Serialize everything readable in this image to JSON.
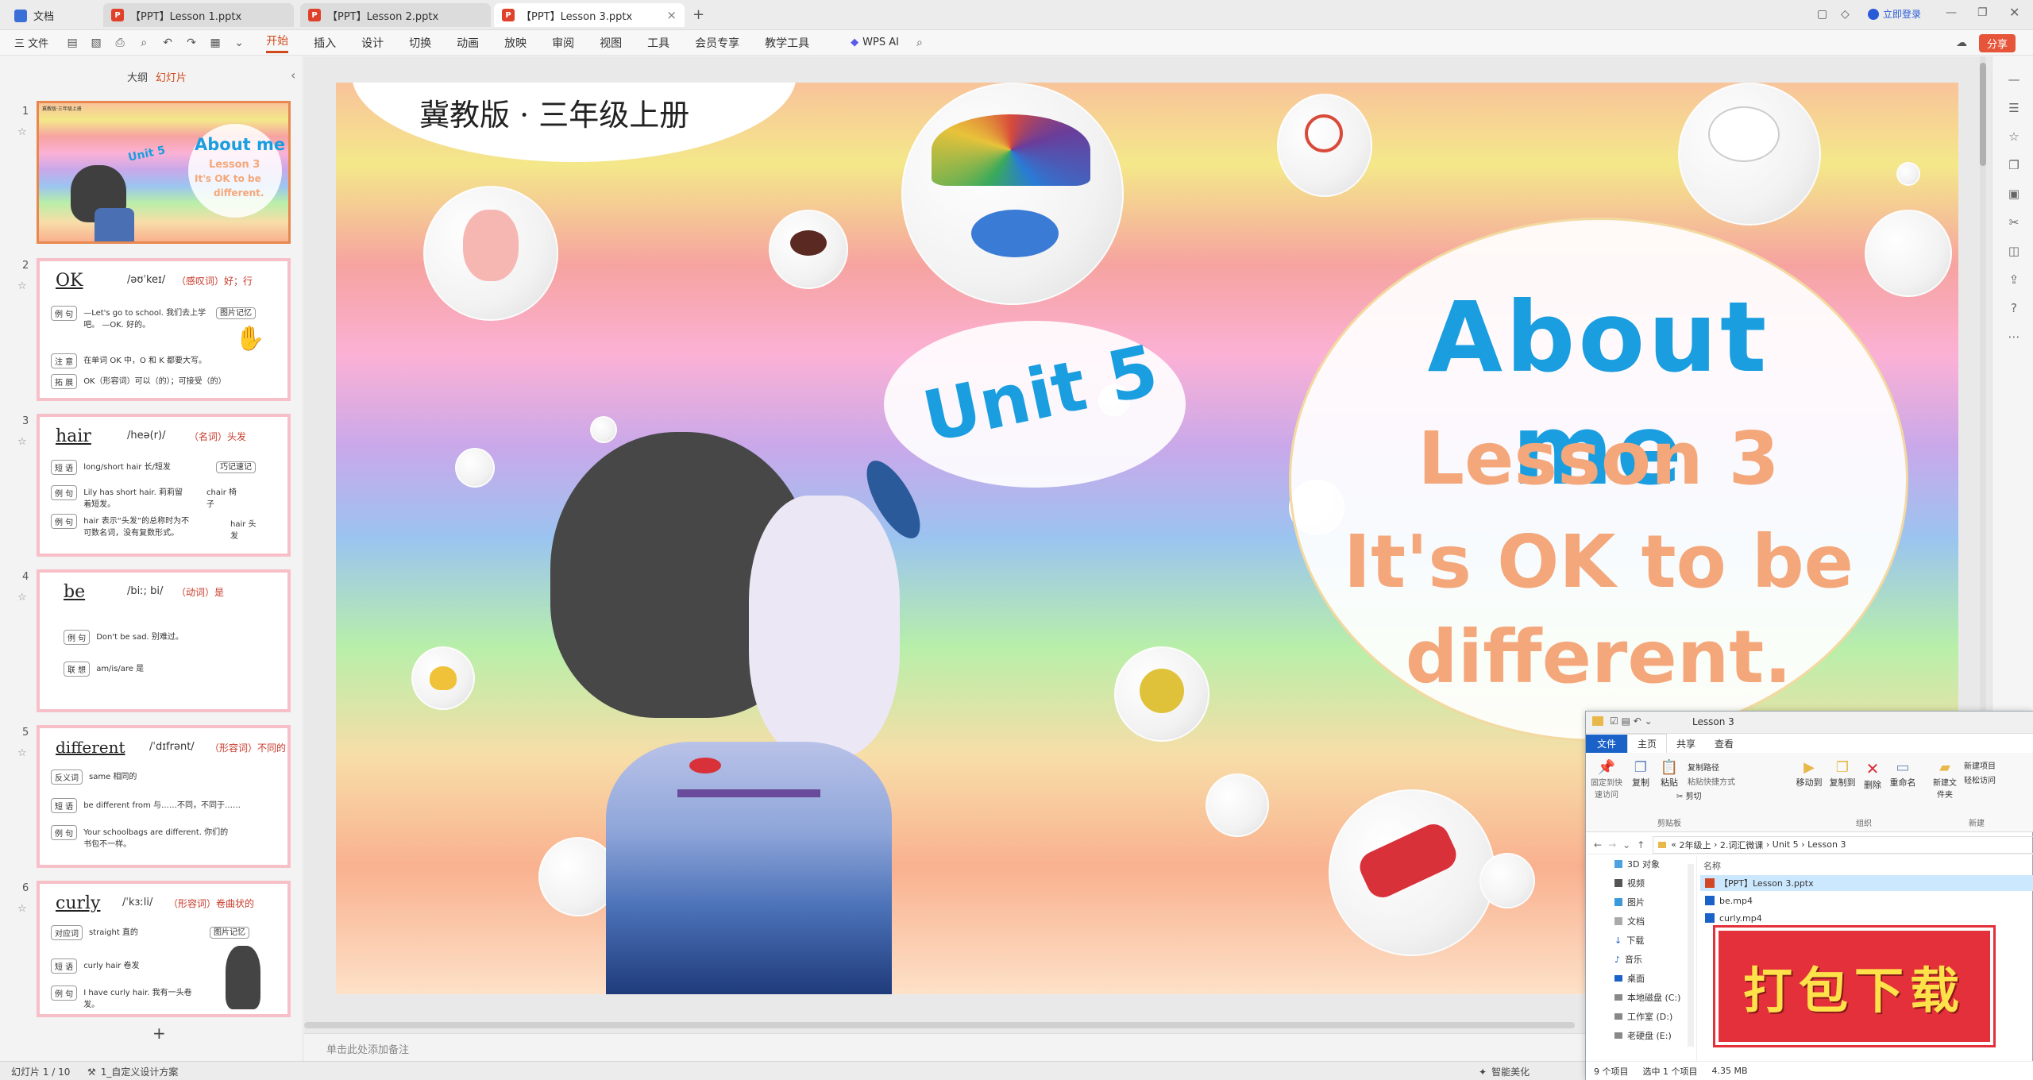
{
  "titlebar": {
    "home_label": "文档",
    "tabs": [
      {
        "label": "【PPT】Lesson 1.pptx",
        "active": false
      },
      {
        "label": "【PPT】Lesson 2.pptx",
        "active": false
      },
      {
        "label": "【PPT】Lesson 3.pptx",
        "active": true
      }
    ],
    "login_label": "立即登录"
  },
  "menubar": {
    "file_label": "三 文件",
    "items": [
      "开始",
      "插入",
      "设计",
      "切换",
      "动画",
      "放映",
      "审阅",
      "视图",
      "工具",
      "会员专享",
      "教学工具"
    ],
    "active_item": "开始",
    "wps_ai_label": "WPS AI",
    "share_label": "分享"
  },
  "left_panel": {
    "tabs": [
      "大纲",
      "幻灯片"
    ],
    "active_tab": "幻灯片",
    "thumbnails": [
      {
        "num": "1",
        "title": "About me",
        "subtitle": "Lesson 3",
        "line1": "It's OK to be",
        "line2": "different.",
        "unit": "Unit 5",
        "header": "冀教版·三年级上册"
      },
      {
        "num": "2",
        "word": "OK",
        "phon": "/əʊˈkeɪ/",
        "meaning": "（感叹词）好；行",
        "rows": [
          {
            "badge": "例 句",
            "text": "—Let's go to school.  我们去上学吧。  —OK. 好的。"
          },
          {
            "badge": "注 意",
            "text": "在单词 OK 中，O 和 K 都要大写。"
          },
          {
            "badge": "拓 展",
            "text": "OK（形容词）可以（的）；可接受（的）"
          }
        ],
        "side": "图片记忆"
      },
      {
        "num": "3",
        "word": "hair",
        "phon": "/heə(r)/",
        "meaning": "（名词）头发",
        "rows": [
          {
            "badge": "短 语",
            "text": "long/short hair 长/短发"
          },
          {
            "badge": "例 句",
            "text": "Lily has short hair.  莉莉留着短发。"
          },
          {
            "badge": "例 句",
            "text": "hair 表示“头发”的总称时为不可数名词，没有复数形式。"
          }
        ],
        "side": "巧记速记",
        "side2": "chair 椅子",
        "side3": "hair 头发"
      },
      {
        "num": "4",
        "word": "be",
        "phon": "/biː; bi/",
        "meaning": "（动词）是",
        "rows": [
          {
            "badge": "例 句",
            "text": "Don't be sad. 别难过。"
          },
          {
            "badge": "联 想",
            "text": "am/is/are 是"
          }
        ]
      },
      {
        "num": "5",
        "word": "different",
        "phon": "/ˈdɪfrənt/",
        "meaning": "（形容词）不同的",
        "rows": [
          {
            "badge": "反义词",
            "text": "same 相同的"
          },
          {
            "badge": "短 语",
            "text": "be different from 与……不同，不同于……"
          },
          {
            "badge": "例 句",
            "text": "Your schoolbags are different.  你们的书包不一样。"
          }
        ]
      },
      {
        "num": "6",
        "word": "curly",
        "phon": "/ˈkɜːli/",
        "meaning": "（形容词）卷曲状的",
        "rows": [
          {
            "badge": "对应词",
            "text": "straight 直的"
          },
          {
            "badge": "短 语",
            "text": "curly hair 卷发"
          },
          {
            "badge": "例 句",
            "text": "I have curly hair.  我有一头卷发。"
          }
        ],
        "side": "图片记忆"
      }
    ],
    "add_label": "+"
  },
  "slide": {
    "header": "冀教版 · 三年级上册",
    "title": "About me",
    "lesson": "Lesson 3",
    "line1": "It's OK to be",
    "line2": "different.",
    "unit": "Unit 5",
    "colors": {
      "title": "#1a9ee0",
      "lesson": "#f4a77a"
    }
  },
  "notes_placeholder": "单击此处添加备注",
  "statusbar": {
    "slide_counter": "幻灯片 1 / 10",
    "theme": "1_自定义设计方案",
    "smart_label": "智能美化"
  },
  "explorer": {
    "title": "Lesson 3",
    "ribbon_tabs": [
      "文件",
      "主页",
      "共享",
      "查看"
    ],
    "active_ribbon_tab": "主页",
    "ribbon": {
      "pin": "固定到快速访问",
      "copy": "复制",
      "paste": "粘贴",
      "copy_path": "复制路径",
      "paste_shortcut": "粘贴快捷方式",
      "cut": "剪切",
      "move_to": "移动到",
      "copy_to": "复制到",
      "delete": "删除",
      "rename": "重命名",
      "new_folder": "新建文件夹",
      "new_item": "新建项目",
      "easy_access": "轻松访问",
      "group_clipboard": "剪贴板",
      "group_organize": "组织",
      "group_new": "新建"
    },
    "breadcrumb": [
      "«",
      "2年级上",
      "2.词汇微课",
      "Unit 5",
      "Lesson 3"
    ],
    "column_header": "名称",
    "nav_items": [
      "3D 对象",
      "视频",
      "图片",
      "文档",
      "下载",
      "音乐",
      "桌面",
      "本地磁盘 (C:)",
      "工作室 (D:)",
      "老硬盘 (E:)"
    ],
    "files": [
      "【PPT】Lesson 3.pptx",
      "be.mp4",
      "curly.mp4"
    ],
    "status_count": "9 个项目",
    "status_selected": "选中 1 个项目",
    "status_size": "4.35 MB"
  },
  "download_banner": "打包下载"
}
